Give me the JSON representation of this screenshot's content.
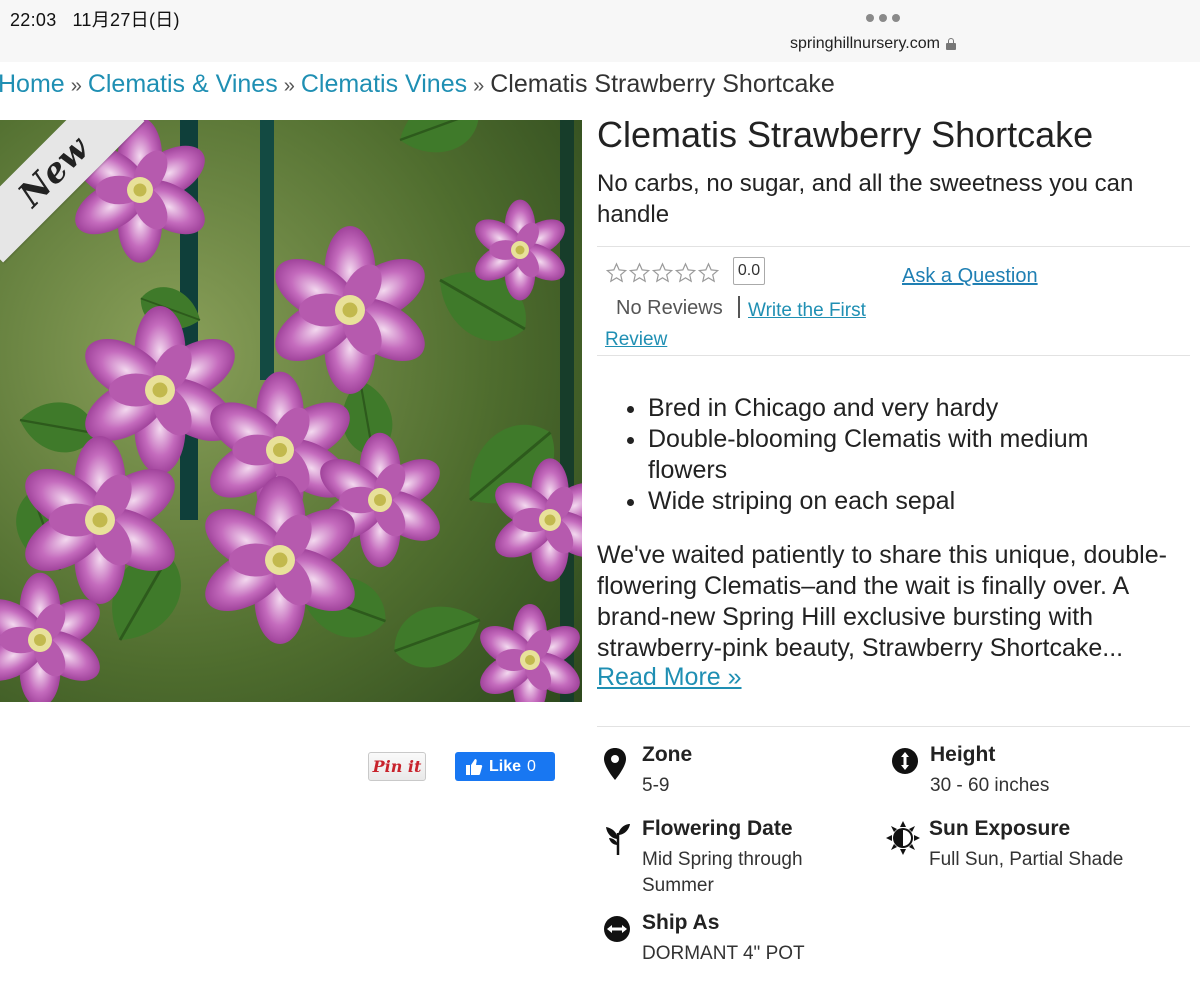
{
  "status_bar": {
    "time": "22:03",
    "date": "11月27日(日)",
    "url": "springhillnursery.com"
  },
  "breadcrumb": {
    "items": [
      {
        "label": "Home"
      },
      {
        "label": "Clematis & Vines"
      },
      {
        "label": "Clematis Vines"
      }
    ],
    "current": "Clematis Strawberry Shortcake",
    "separator": "»"
  },
  "product_image": {
    "badge": "New",
    "alt_subject": "Clematis flowers"
  },
  "social": {
    "pin_label": "Pin it",
    "like_label": "Like",
    "like_count": "0"
  },
  "product": {
    "title": "Clematis Strawberry Shortcake",
    "tagline": "No carbs, no sugar, and all the sweetness you can handle",
    "rating_value": "0.0",
    "stars_filled": 0,
    "stars_total": 5,
    "no_reviews": "No Reviews",
    "write_review": "Write the First Review",
    "ask_question": "Ask a Question",
    "bullets": [
      "Bred in Chicago and very hardy",
      "Double-blooming Clematis with medium flowers",
      "Wide striping on each sepal"
    ],
    "description": "We've waited patiently to share this unique, double-flowering Clematis–and the wait is finally over. A brand-new Spring Hill exclusive bursting with strawberry-pink beauty, Strawberry Shortcake...",
    "read_more": "Read More »"
  },
  "attributes": {
    "zone": {
      "label": "Zone",
      "value": "5-9",
      "icon": "location-pin-icon"
    },
    "height": {
      "label": "Height",
      "value": "30 - 60 inches",
      "icon": "height-arrows-icon"
    },
    "flowering": {
      "label": "Flowering Date",
      "value": "Mid Spring through Summer",
      "icon": "sprout-icon"
    },
    "sun": {
      "label": "Sun Exposure",
      "value": "Full Sun, Partial Shade",
      "icon": "sun-icon"
    },
    "ship": {
      "label": "Ship As",
      "value": "DORMANT 4\" POT",
      "icon": "ship-arrows-icon"
    }
  },
  "colors": {
    "link": "#1f8fb3",
    "facebook": "#1877f2",
    "pinterest": "#c8232c"
  }
}
